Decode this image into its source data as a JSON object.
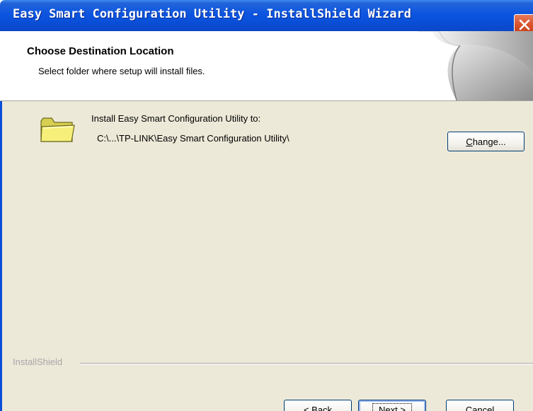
{
  "window": {
    "title": "Easy Smart Configuration Utility - InstallShield Wizard",
    "close_icon": "close-icon",
    "titlebar_color": "#0a4fd8",
    "body_color": "#ece9d8"
  },
  "header": {
    "title": "Choose Destination Location",
    "subtitle": "Select folder where setup will install files."
  },
  "destination": {
    "folder_icon": "folder-icon",
    "label": "Install Easy Smart Configuration Utility to:",
    "path": "C:\\...\\TP-LINK\\Easy Smart Configuration Utility\\",
    "change_button": {
      "mnemonic": "C",
      "rest": "hange..."
    }
  },
  "footer": {
    "brand": "InstallShield",
    "back_button": {
      "prefix": "< ",
      "mnemonic": "B",
      "rest": "ack"
    },
    "next_button": {
      "mnemonic": "N",
      "rest": "ext >"
    },
    "cancel_button": "Cancel"
  }
}
